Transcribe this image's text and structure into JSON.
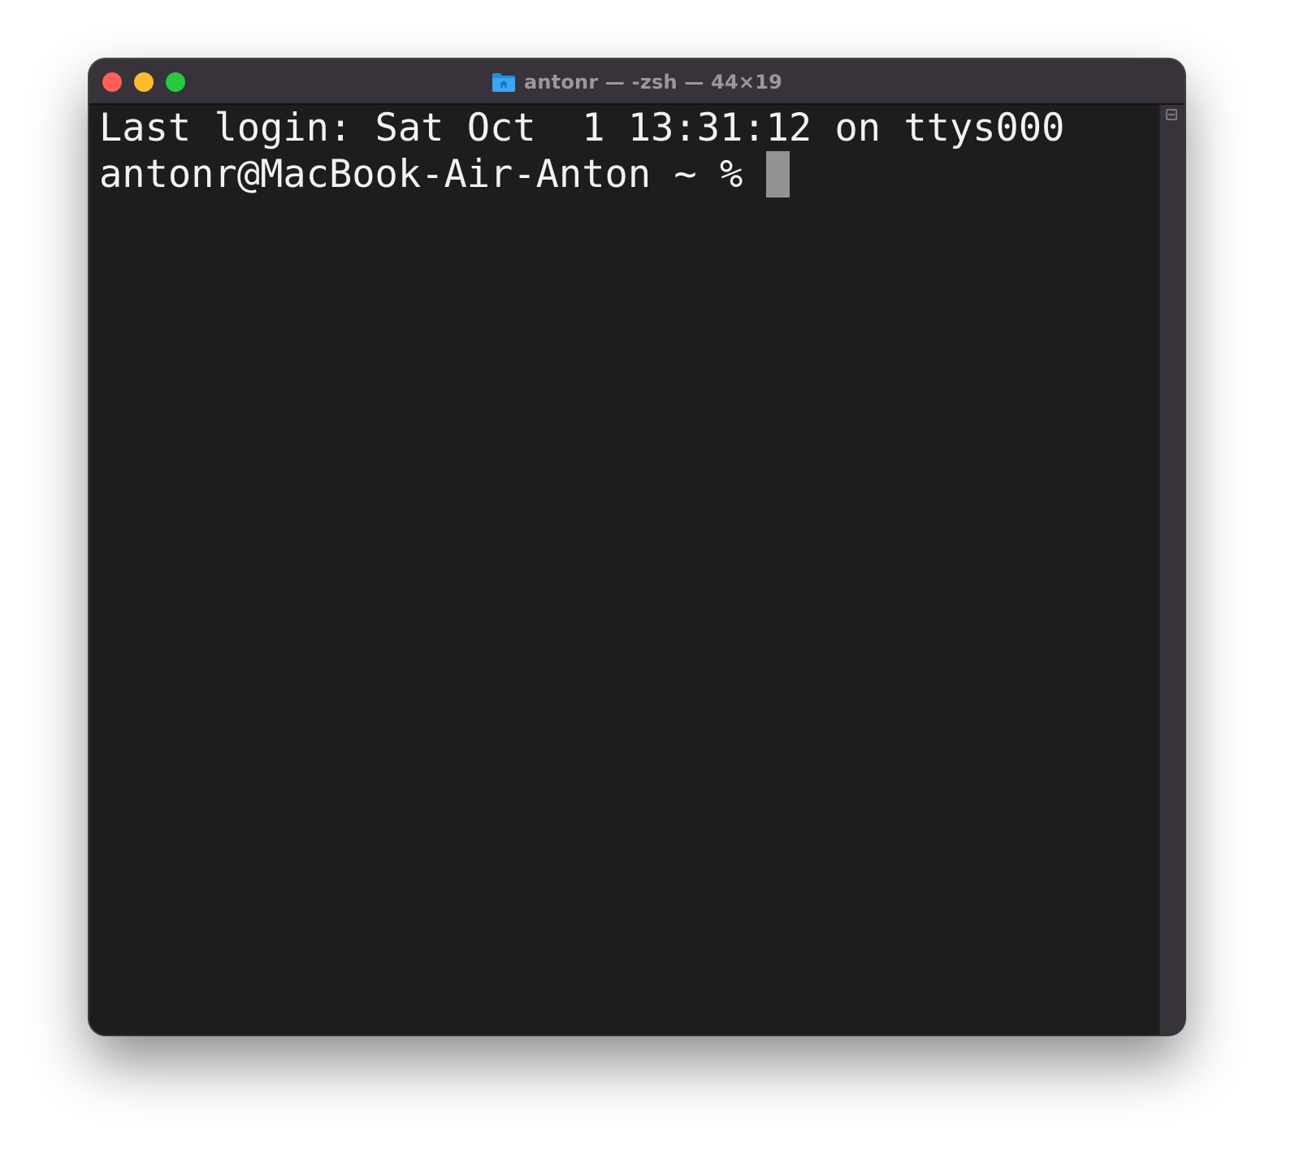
{
  "window": {
    "title": "antonr — -zsh — 44×19",
    "title_icon": "home-folder-icon",
    "traffic_lights": {
      "close_color": "#fe5f57",
      "minimize_color": "#febc2e",
      "zoom_color": "#28c840"
    }
  },
  "terminal": {
    "lines": [
      "Last login: Sat Oct  1 13:31:12 on ttys000",
      "antonr@MacBook-Air-Anton ~ % "
    ],
    "colors": {
      "background": "#1d1d1d",
      "foreground": "#f2f2f2",
      "cursor": "#939393"
    }
  },
  "scrollbar": {
    "icon": "split-pane-icon"
  }
}
